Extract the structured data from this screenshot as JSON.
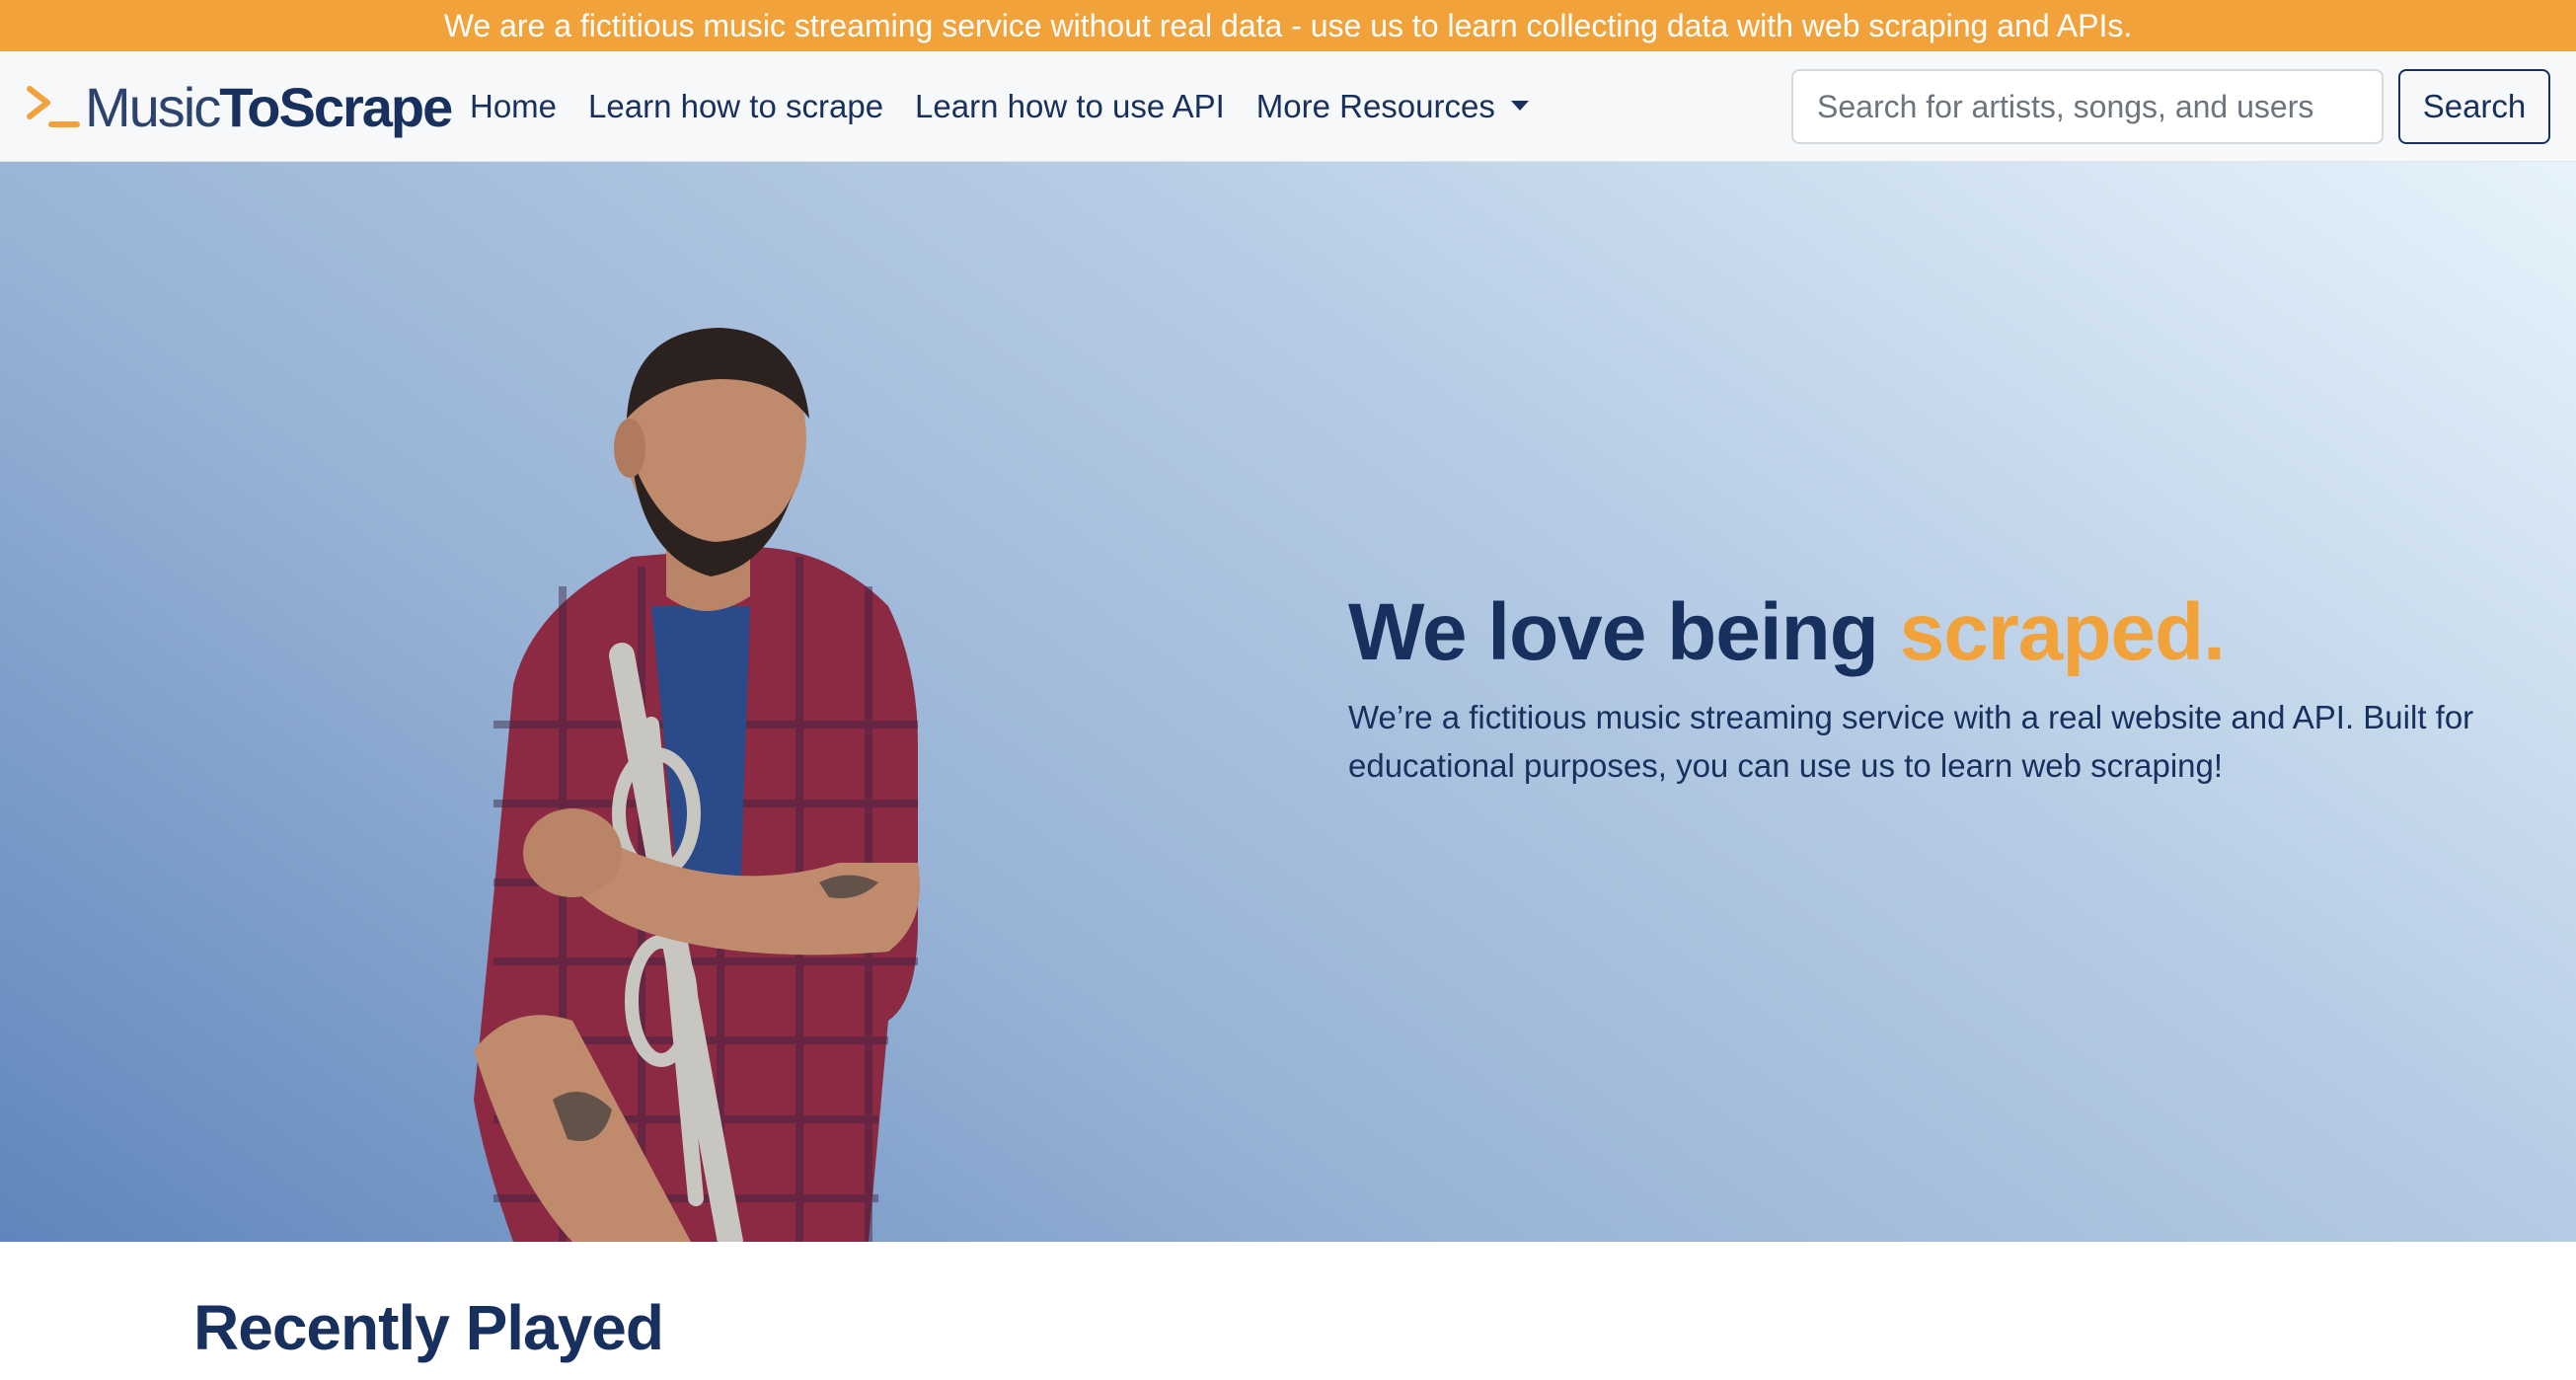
{
  "banner": {
    "text": "We are a fictitious music streaming service without real data - use us to learn collecting data with web scraping and APIs."
  },
  "navbar": {
    "logo": {
      "prompt_icon": "terminal-prompt-icon",
      "part1": "Music",
      "part2": "ToScrape"
    },
    "links": [
      {
        "label": "Home"
      },
      {
        "label": "Learn how to scrape"
      },
      {
        "label": "Learn how to use API"
      },
      {
        "label": "More Resources"
      }
    ],
    "search": {
      "placeholder": "Search for artists, songs, and users",
      "value": "",
      "button_label": "Search"
    }
  },
  "hero": {
    "title_main": "We love being ",
    "title_accent": "scraped.",
    "subtitle": "We’re a fictitious music streaming service with a real website and API. Built for educational purposes, you can use us to learn web scraping!"
  },
  "recently_played": {
    "heading": "Recently Played"
  },
  "colors": {
    "brand_navy": "#17305e",
    "accent_orange": "#f2a23a",
    "navbar_bg": "#f7f8fa"
  }
}
